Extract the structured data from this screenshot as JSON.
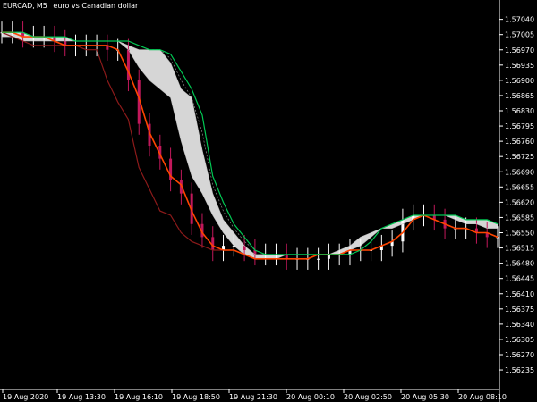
{
  "window": {
    "symbol": "EURCAD",
    "timeframe": "M5",
    "description": "euro vs Canadian dollar"
  },
  "colors": {
    "background": "#000000",
    "axis": "#ffffff",
    "bull_candle": "#ffffff",
    "bear_candle": "#c2185b",
    "cloud_fill": "#e8e8e8",
    "tenkan": "#ff4500",
    "kijun": "#8b1a1a",
    "green_line": "#00c853"
  },
  "chart_data": {
    "type": "line",
    "title": "EURCAD,M5  euro vs Canadian dollar",
    "ylim": [
      1.5619,
      1.5707
    ],
    "y_ticks": [
      "1.57040",
      "1.57005",
      "1.56970",
      "1.56935",
      "1.56900",
      "1.56865",
      "1.56830",
      "1.56795",
      "1.56760",
      "1.56725",
      "1.56690",
      "1.56655",
      "1.56620",
      "1.56585",
      "1.56550",
      "1.56515",
      "1.56480",
      "1.56445",
      "1.56410",
      "1.56375",
      "1.56340",
      "1.56305",
      "1.56270",
      "1.56235"
    ],
    "x_ticks": [
      "19 Aug 2020",
      "19 Aug 13:30",
      "19 Aug 16:10",
      "19 Aug 18:50",
      "19 Aug 21:30",
      "20 Aug 00:10",
      "20 Aug 02:50",
      "20 Aug 05:30",
      "20 Aug 08:10"
    ],
    "grid": false,
    "series": [
      {
        "values": [
          1.5701,
          1.5701,
          1.57,
          1.57,
          1.57,
          1.5699,
          1.5698,
          1.5698,
          1.5698,
          1.5698,
          1.5697,
          1.5697,
          1.569,
          1.568,
          1.5675,
          1.5672,
          1.5667,
          1.5664,
          1.5657,
          1.5654,
          1.5651,
          1.5652,
          1.5652,
          1.5651,
          1.565,
          1.565,
          1.565,
          1.5649,
          1.5649,
          1.5649,
          1.5649,
          1.565,
          1.565,
          1.5651,
          1.5651,
          1.5651,
          1.5652,
          1.5653,
          1.5658,
          1.5659,
          1.5659,
          1.5658,
          1.5656,
          1.5656,
          1.5656,
          1.5655,
          1.5654,
          1.5654
        ]
      },
      {
        "values": [
          1.5701,
          1.5701,
          1.57,
          1.57,
          1.57,
          1.5699,
          1.5698,
          1.5698,
          1.5698,
          1.5698,
          1.5698,
          1.5697,
          1.5692,
          1.5686,
          1.5678,
          1.5673,
          1.5668,
          1.5666,
          1.566,
          1.5655,
          1.5652,
          1.5651,
          1.5651,
          1.565,
          1.5649,
          1.5649,
          1.5649,
          1.5649,
          1.5649,
          1.5649,
          1.565,
          1.565,
          1.565,
          1.5651,
          1.5651,
          1.5651,
          1.5652,
          1.5653,
          1.5655,
          1.5658,
          1.5659,
          1.5658,
          1.5657,
          1.5656,
          1.5656,
          1.5655,
          1.5655,
          1.5654
        ]
      },
      {
        "values": [
          1.5701,
          1.57,
          1.5699,
          1.5698,
          1.5698,
          1.5698,
          1.5698,
          1.5698,
          1.5697,
          1.5697,
          1.569,
          1.5685,
          1.5681,
          1.567,
          1.5665,
          1.566,
          1.5659,
          1.5655,
          1.5653,
          1.5652,
          1.5651,
          1.5651,
          1.5651,
          1.565,
          1.5649,
          1.5649,
          1.5649,
          1.5649,
          1.5649,
          1.5649,
          1.565,
          1.565,
          1.565,
          1.5651,
          1.5651,
          1.5651,
          1.5652,
          1.5653,
          1.5655,
          1.5658,
          1.5659,
          1.5658,
          1.5657,
          1.5656,
          1.5656,
          1.5655,
          1.5655,
          1.5654
        ]
      },
      {
        "values": [
          1.57,
          1.57,
          1.5699,
          1.5699,
          1.5699,
          1.5699,
          1.5699,
          1.5699,
          1.5699,
          1.5699,
          1.5699,
          1.5699,
          1.5697,
          1.5693,
          1.569,
          1.5688,
          1.5686,
          1.5676,
          1.5668,
          1.5664,
          1.5659,
          1.5655,
          1.5652,
          1.565,
          1.5649,
          1.5649,
          1.5649,
          1.565,
          1.565,
          1.565,
          1.565,
          1.565,
          1.5651,
          1.5652,
          1.5654,
          1.5655,
          1.5656,
          1.5656,
          1.5657,
          1.5658,
          1.5659,
          1.5659,
          1.5659,
          1.5658,
          1.5657,
          1.5657,
          1.5656,
          1.5656
        ]
      },
      {
        "values": [
          1.5701,
          1.5701,
          1.5701,
          1.57,
          1.57,
          1.57,
          1.57,
          1.5699,
          1.5699,
          1.5699,
          1.5699,
          1.5699,
          1.5698,
          1.5697,
          1.5697,
          1.5697,
          1.5694,
          1.5688,
          1.5686,
          1.5674,
          1.5664,
          1.5658,
          1.5655,
          1.5652,
          1.565,
          1.565,
          1.565,
          1.565,
          1.565,
          1.565,
          1.565,
          1.565,
          1.565,
          1.5651,
          1.5652,
          1.5654,
          1.5656,
          1.5657,
          1.5658,
          1.5659,
          1.5659,
          1.5659,
          1.5659,
          1.5659,
          1.5658,
          1.5658,
          1.5658,
          1.5657
        ]
      },
      {
        "values": [
          1.5701,
          1.5701,
          1.5701,
          1.57,
          1.57,
          1.57,
          1.57,
          1.5699,
          1.5699,
          1.5699,
          1.5699,
          1.5699,
          1.5699,
          1.5698,
          1.5697,
          1.5697,
          1.5695,
          1.569,
          1.5686,
          1.5678,
          1.5666,
          1.566,
          1.5656,
          1.5653,
          1.5651,
          1.565,
          1.565,
          1.565,
          1.565,
          1.565,
          1.565,
          1.565,
          1.565,
          1.565,
          1.5651,
          1.5653,
          1.5656,
          1.5657,
          1.5658,
          1.5659,
          1.5659,
          1.5659,
          1.5659,
          1.5659,
          1.5658,
          1.5658,
          1.5658,
          1.5657
        ]
      },
      {
        "values": [
          1.5701,
          1.5701,
          1.5701,
          1.57,
          1.57,
          1.57,
          1.57,
          1.5699,
          1.5699,
          1.5699,
          1.5699,
          1.5699,
          1.5699,
          1.5698,
          1.5697,
          1.5697,
          1.5696,
          1.5692,
          1.5688,
          1.5682,
          1.5668,
          1.5662,
          1.5657,
          1.5654,
          1.5651,
          1.565,
          1.565,
          1.565,
          1.565,
          1.565,
          1.565,
          1.565,
          1.565,
          1.565,
          1.5651,
          1.5653,
          1.5656,
          1.5657,
          1.5658,
          1.5659,
          1.5659,
          1.5659,
          1.5659,
          1.5659,
          1.5658,
          1.5658,
          1.5658,
          1.5657
        ]
      }
    ]
  }
}
